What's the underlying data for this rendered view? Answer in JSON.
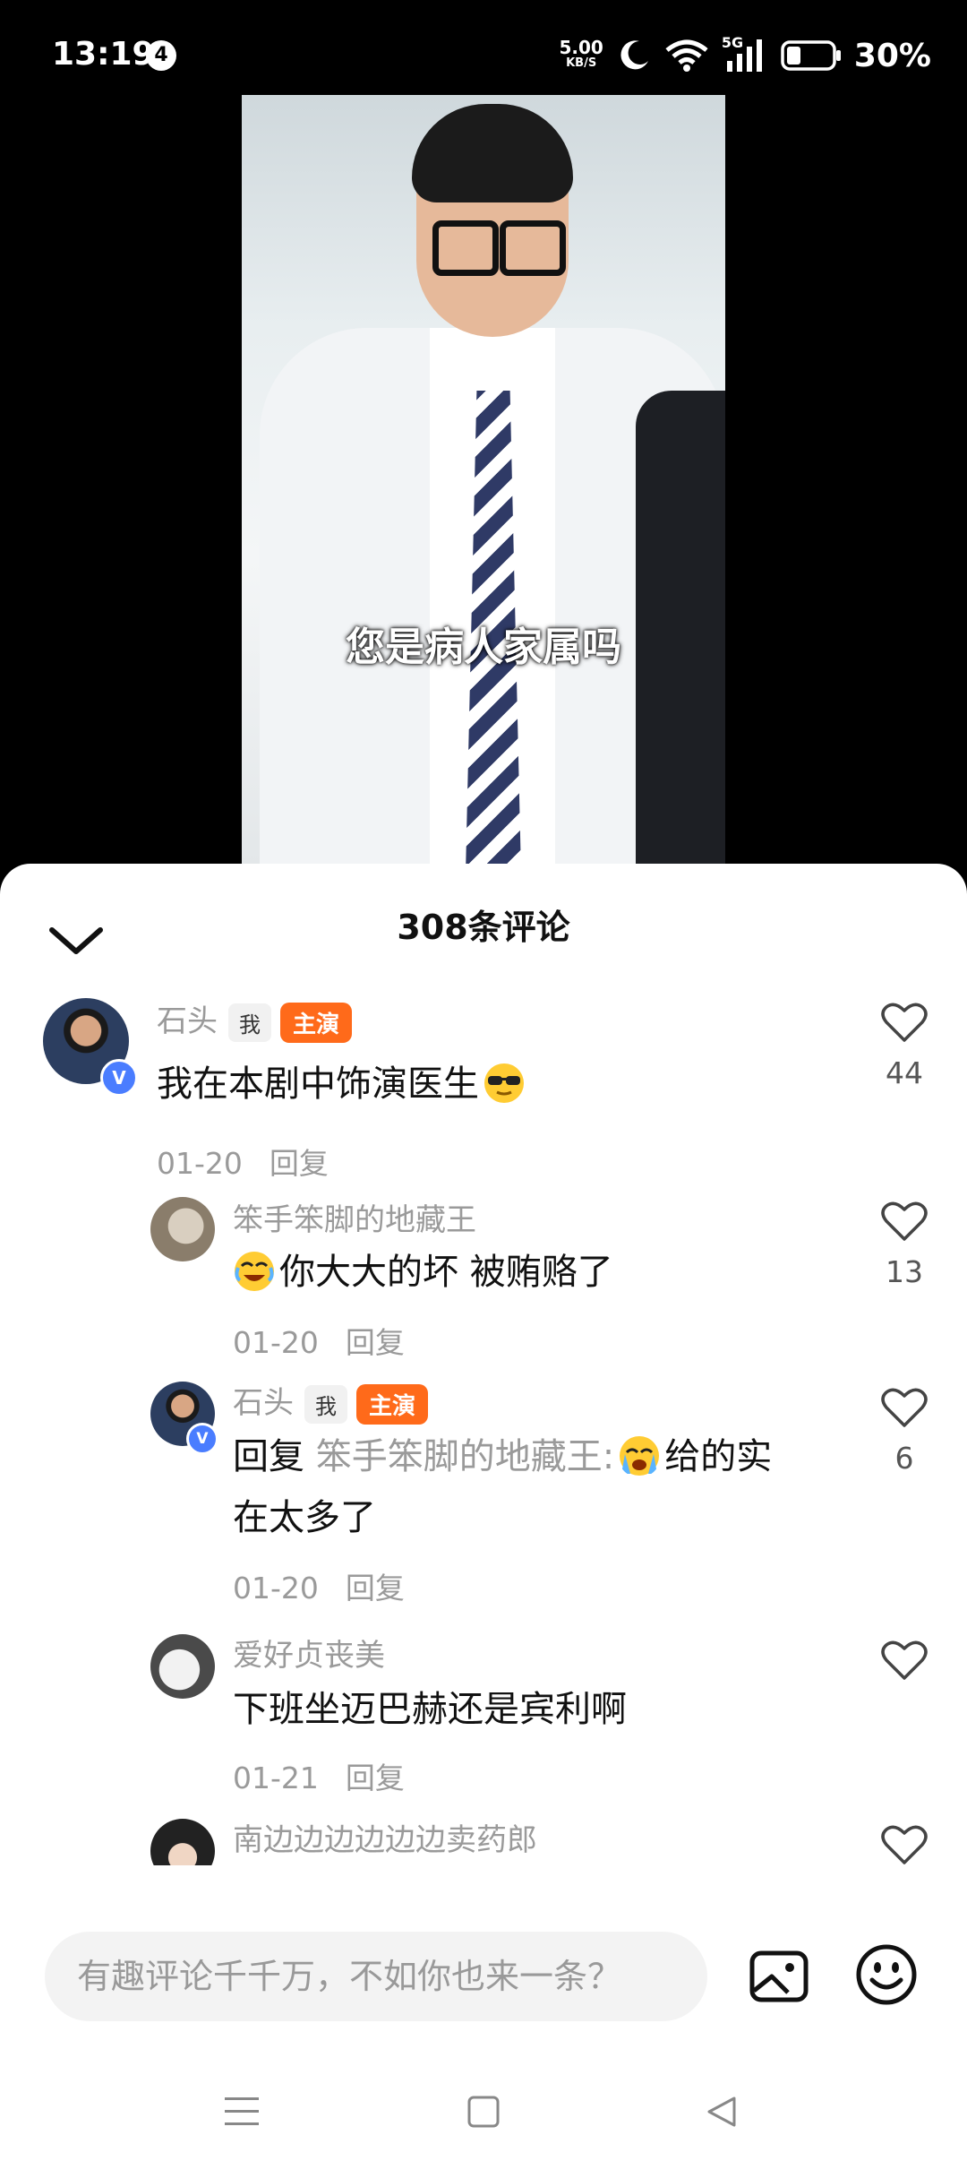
{
  "status_bar": {
    "time": "13:19",
    "notification_count": "4",
    "net_speed": "5.00",
    "net_speed_unit": "KB/S",
    "network": "5G",
    "battery": "30%"
  },
  "video": {
    "subtitle": "您是病人家属吗"
  },
  "comments_panel": {
    "title": "308条评论",
    "input_placeholder": "有趣评论千千万，不如你也来一条？",
    "comments": [
      {
        "author": "石头",
        "tag_me": "我",
        "tag_role": "主演",
        "text": "我在本剧中饰演医生",
        "date": "01-20",
        "reply_label": "回复",
        "likes": "44"
      },
      {
        "author": "笨手笨脚的地藏王",
        "text": "你大大的坏 被贿赂了",
        "date": "01-20",
        "reply_label": "回复",
        "likes": "13"
      },
      {
        "author": "石头",
        "tag_me": "我",
        "tag_role": "主演",
        "reply_prefix": "回复",
        "reply_to": "笨手笨脚的地藏王:",
        "text_line1": "给的实",
        "text_line2": "在太多了",
        "date": "01-20",
        "reply_label": "回复",
        "likes": "6"
      },
      {
        "author": "爱好贞丧美",
        "text": "下班坐迈巴赫还是宾利啊",
        "date": "01-21",
        "reply_label": "回复"
      },
      {
        "author": "南边边边边边边卖药郎"
      }
    ]
  },
  "colors": {
    "accent_orange": "#ff6a1a",
    "verified_blue": "#4a7dff"
  }
}
